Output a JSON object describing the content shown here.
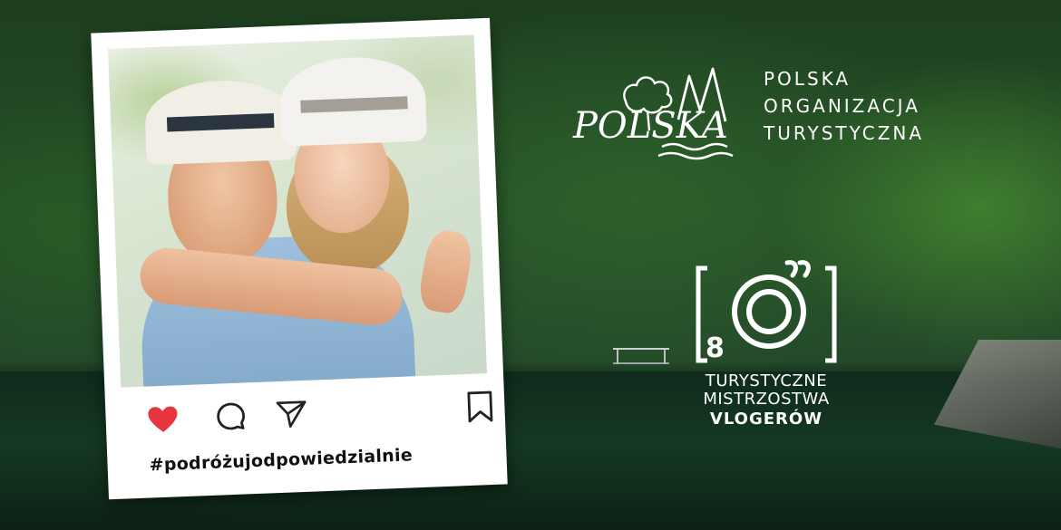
{
  "hashtag": "#podróżujodpowiedzialnie",
  "logo_polska": {
    "mark_text": "POLSKA",
    "org_lines": [
      "POLSKA",
      "ORGANIZACJA",
      "TURYSTYCZNA"
    ]
  },
  "vlog_logo": {
    "number": "8",
    "line1": "TURYSTYCZNE",
    "line2": "MISTRZOSTWA",
    "line3": "VLOGERÓW"
  },
  "icons": [
    "heart-icon",
    "comment-icon",
    "share-icon",
    "bookmark-icon"
  ],
  "colors": {
    "heart": "#e8343d",
    "text_white": "#ffffff",
    "forest": "#264f26"
  }
}
